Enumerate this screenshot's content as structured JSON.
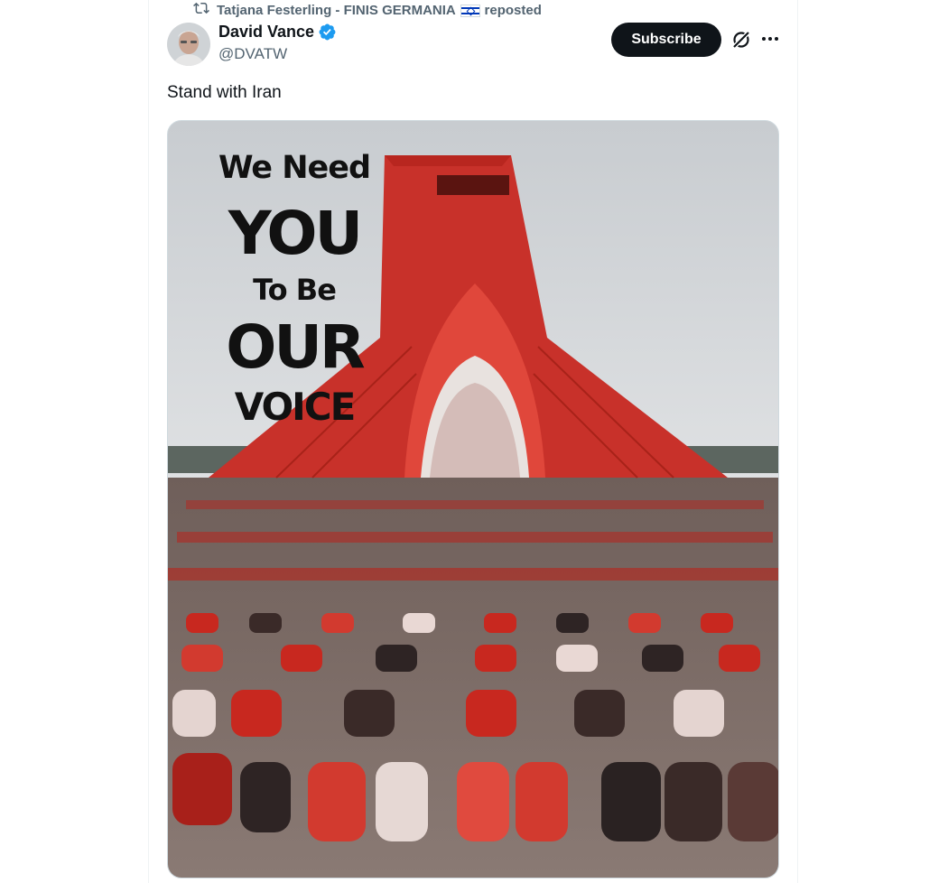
{
  "repost": {
    "reposter_name": "Tatjana Festerling - FINIS GERMANIA",
    "label": "reposted",
    "icon": "repost-icon",
    "flag_icon": "israel-flag-icon"
  },
  "author": {
    "display_name": "David Vance",
    "handle": "@DVATW",
    "verified": true,
    "verified_color": "#1d9bf0"
  },
  "actions": {
    "subscribe_label": "Subscribe",
    "grok_icon": "grok-icon",
    "more_icon": "more-icon"
  },
  "tweet": {
    "text": "Stand with Iran"
  },
  "media": {
    "poster_lines": [
      "We Need",
      "YOU",
      "To Be",
      "OUR",
      "VOICE"
    ],
    "accent_color": "#d8271c"
  }
}
